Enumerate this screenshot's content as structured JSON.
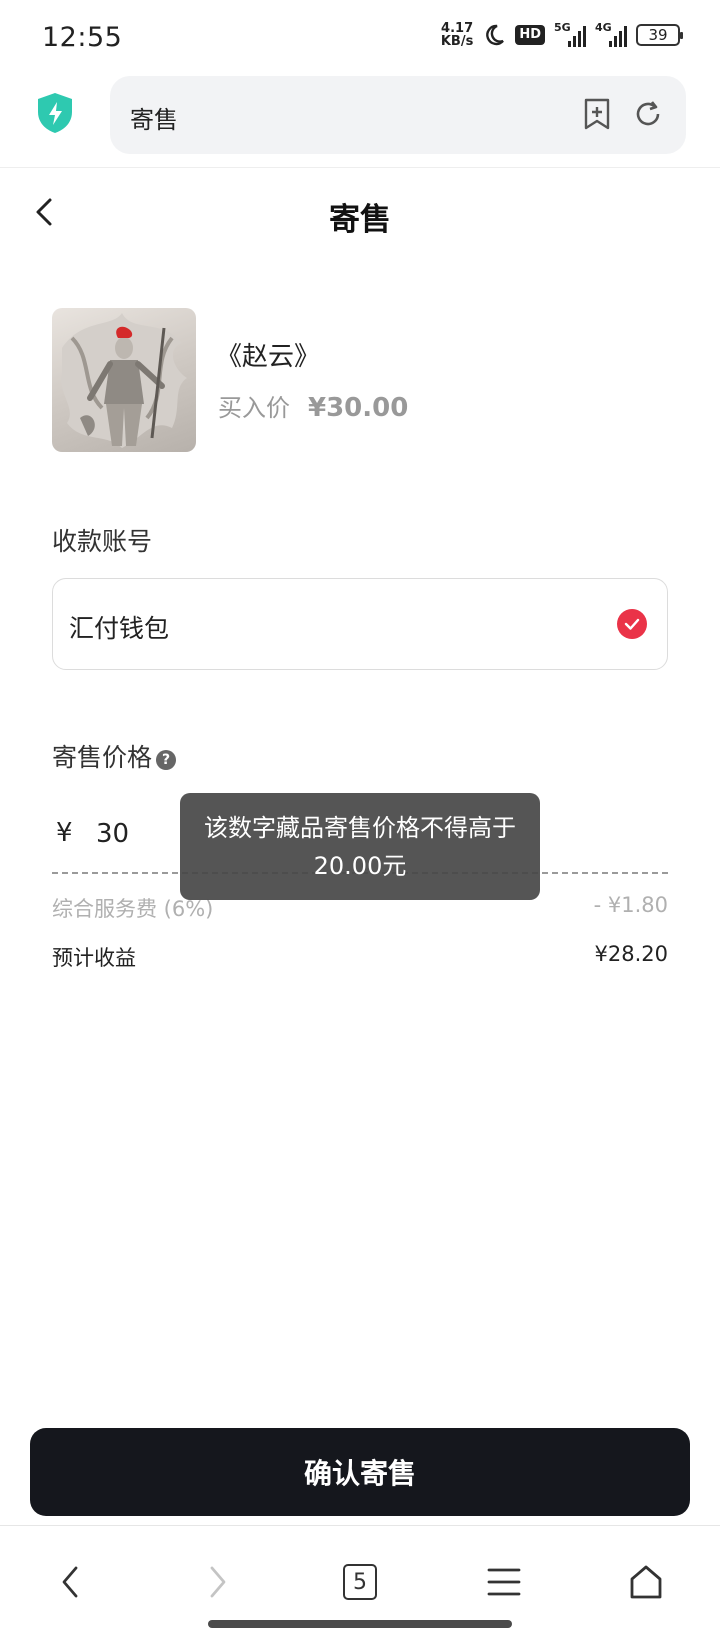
{
  "status_bar": {
    "time": "12:55",
    "net_speed_value": "4.17",
    "net_speed_unit": "KB/s",
    "hd_badge": "HD",
    "signal_1": "5G",
    "signal_2": "4G",
    "battery": "39"
  },
  "browser": {
    "url_text": "寄售",
    "icons": [
      "shield-icon",
      "bookmark-add-icon",
      "reload-icon"
    ]
  },
  "header": {
    "title": "寄售"
  },
  "product": {
    "name": "《赵云》",
    "price_label": "买入价",
    "price_value": "¥30.00"
  },
  "account": {
    "label": "收款账号",
    "selected": "汇付钱包"
  },
  "price": {
    "label": "寄售价格",
    "help_icon": "?",
    "currency": "¥",
    "value": "30",
    "fee_label": "综合服务费 (6%)",
    "fee_value": "- ¥1.80",
    "income_label": "预计收益",
    "income_value": "¥28.20"
  },
  "toast": {
    "message": "该数字藏品寄售价格不得高于20.00元"
  },
  "confirm_button": "确认寄售",
  "bottom_nav": {
    "tab_count": "5",
    "icons": [
      "back-icon",
      "forward-icon",
      "tabs-icon",
      "menu-icon",
      "home-icon"
    ]
  },
  "colors": {
    "accent_red": "#ea3348",
    "button_dark": "#15171d",
    "shield_teal": "#2ec9b0"
  }
}
